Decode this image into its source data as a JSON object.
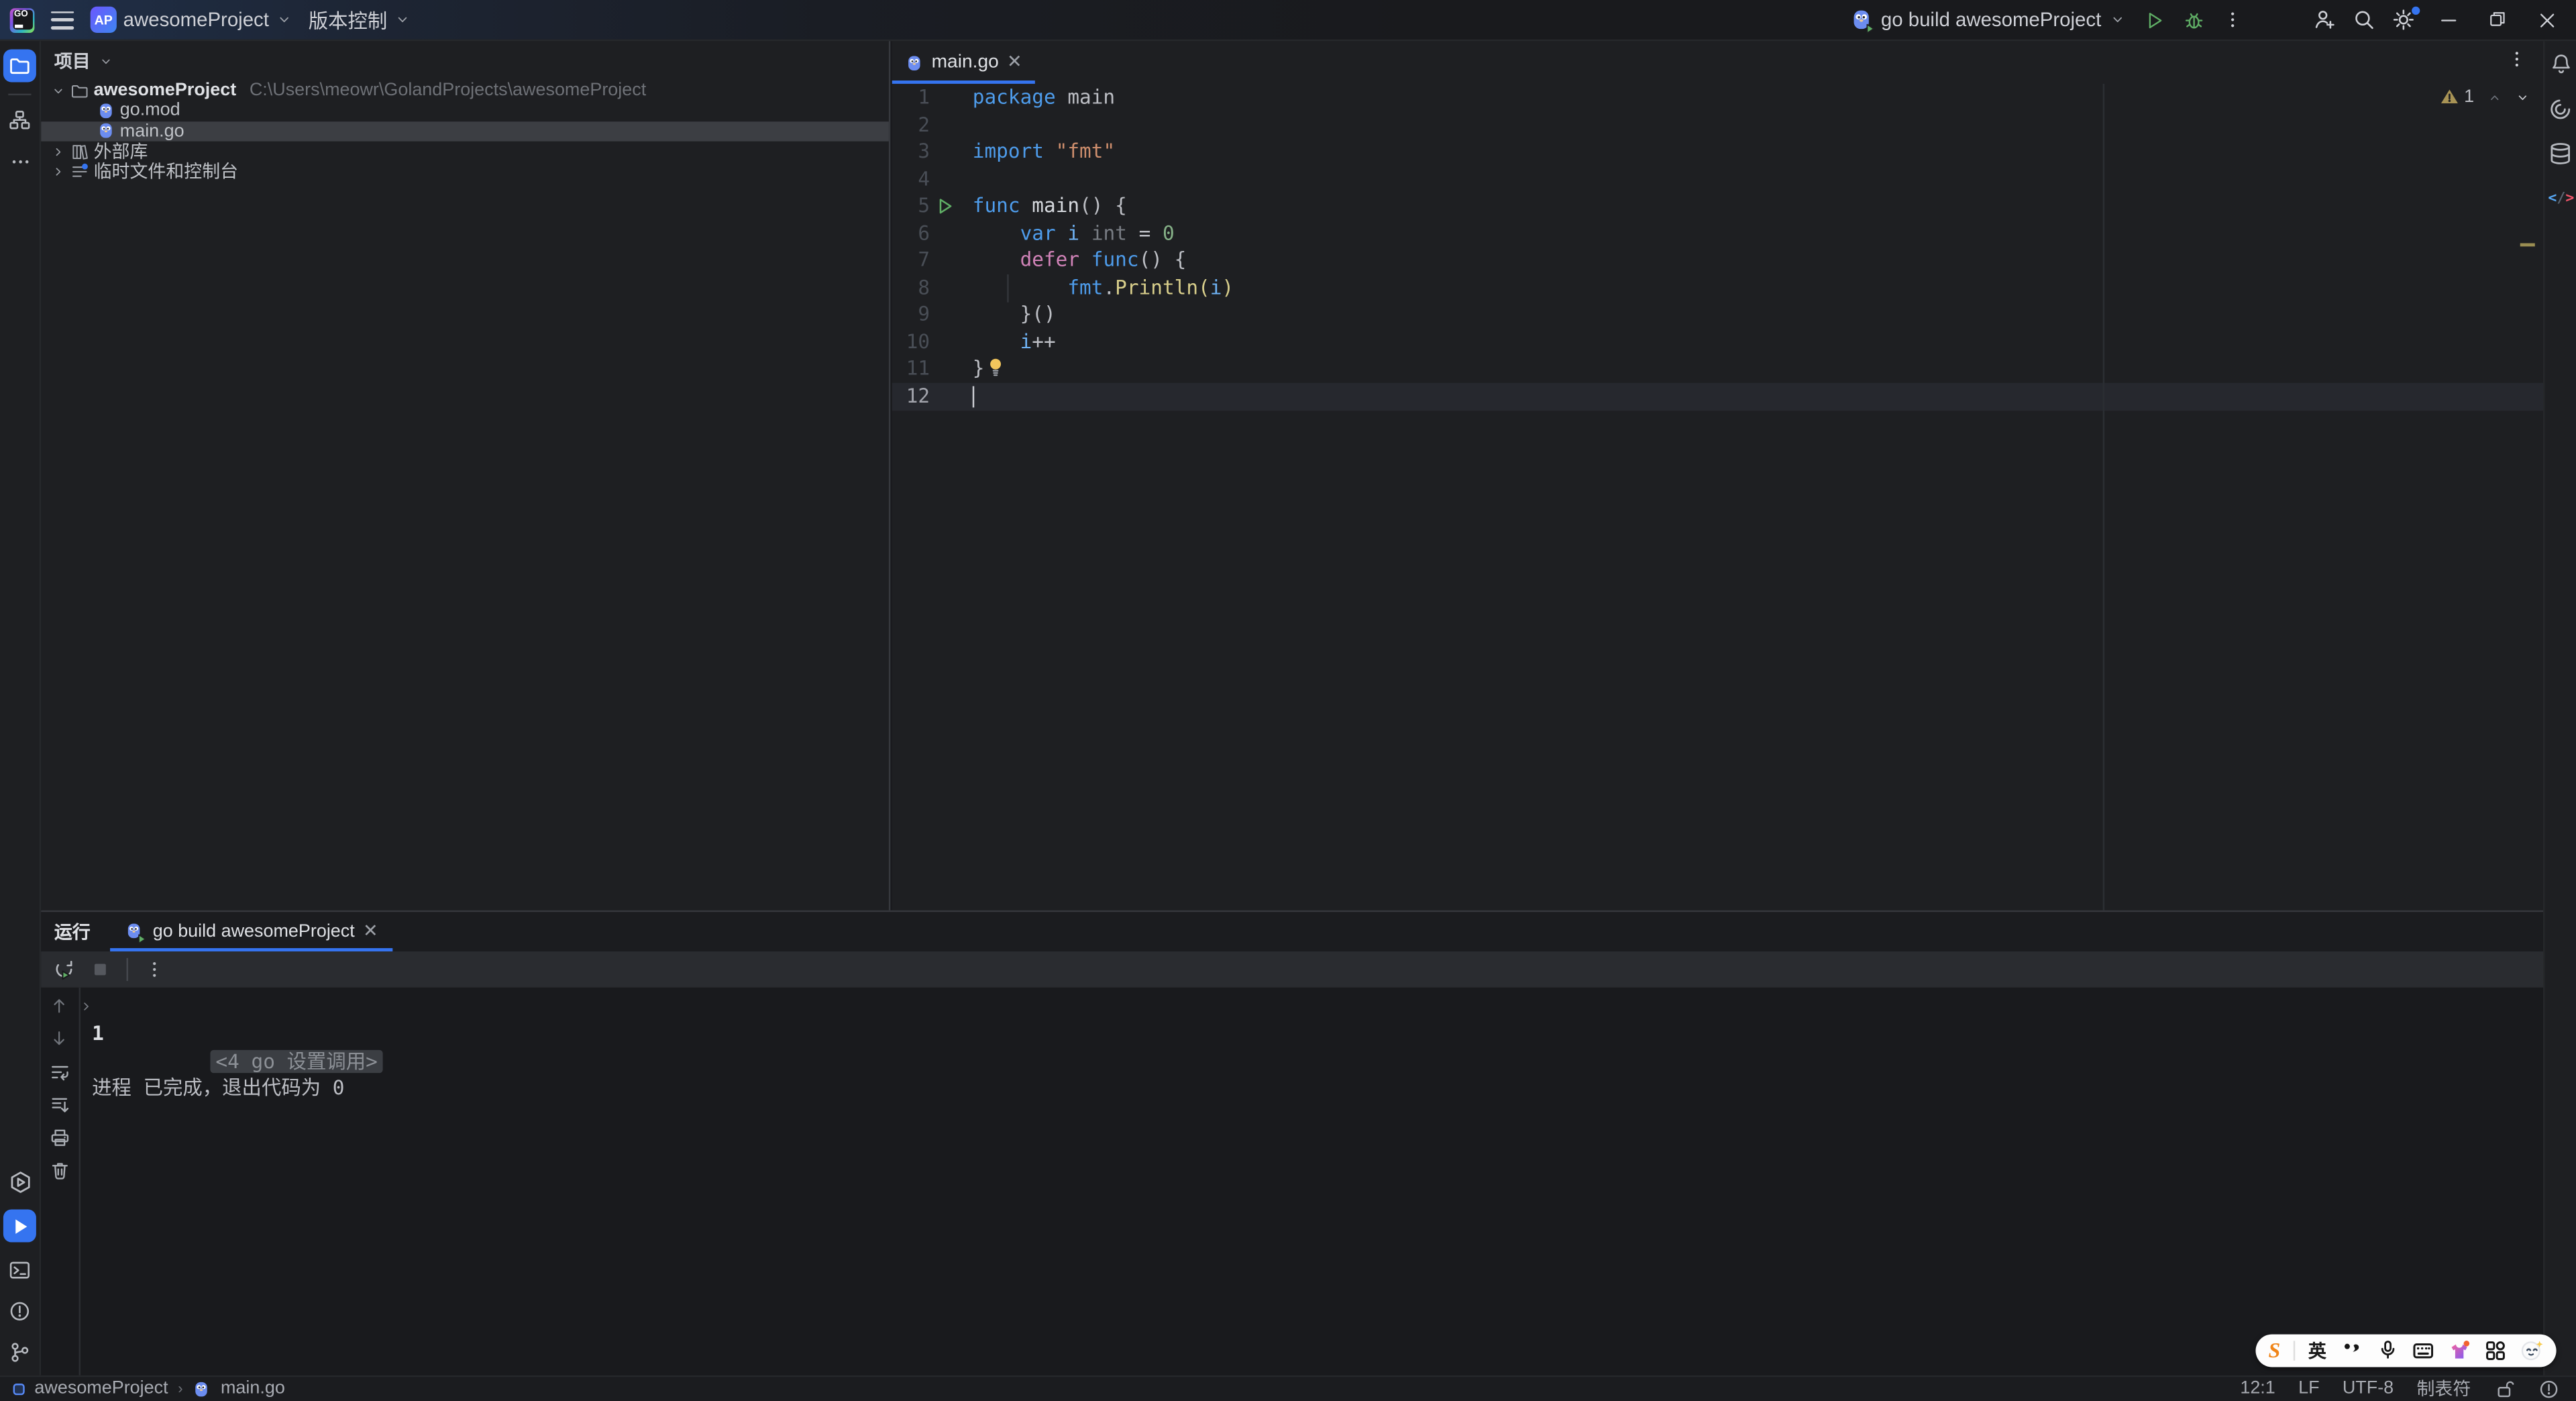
{
  "colors": {
    "accent": "#3574F0",
    "run_green": "#5FAD65",
    "warning": "#A89355",
    "selection": "#3C3E43"
  },
  "titlebar": {
    "project_badge": "AP",
    "project_name": "awesomeProject",
    "vcs_label": "版本控制",
    "run_config": "go build awesomeProject"
  },
  "project_panel": {
    "header": "项目",
    "root_name": "awesomeProject",
    "root_path": "C:\\Users\\meowr\\GolandProjects\\awesomeProject",
    "file_gomod": "go.mod",
    "file_maingo": "main.go",
    "external_libs": "外部库",
    "scratches": "临时文件和控制台"
  },
  "editor": {
    "tab_title": "main.go",
    "warning_count": "1",
    "lines": [
      {
        "n": "1",
        "tokens": [
          [
            "kw",
            "package"
          ],
          [
            "plain",
            " main"
          ]
        ]
      },
      {
        "n": "2",
        "tokens": []
      },
      {
        "n": "3",
        "tokens": [
          [
            "kw",
            "import"
          ],
          [
            "str",
            " \"fmt\""
          ]
        ]
      },
      {
        "n": "4",
        "tokens": []
      },
      {
        "n": "5",
        "run": true,
        "tokens": [
          [
            "kw",
            "func"
          ],
          [
            "plain",
            " "
          ],
          [
            "decl",
            "main"
          ],
          [
            "plain",
            "() {"
          ]
        ]
      },
      {
        "n": "6",
        "tokens": [
          [
            "plain",
            "    "
          ],
          [
            "kw",
            "var"
          ],
          [
            "plain",
            " "
          ],
          [
            "var",
            "i"
          ],
          [
            "type",
            " int"
          ],
          [
            "plain",
            " = "
          ],
          [
            "num",
            "0"
          ]
        ]
      },
      {
        "n": "7",
        "tokens": [
          [
            "plain",
            "    "
          ],
          [
            "kw2",
            "defer"
          ],
          [
            "plain",
            " "
          ],
          [
            "kw",
            "func"
          ],
          [
            "plain",
            "() {"
          ]
        ]
      },
      {
        "n": "8",
        "tokens": [
          [
            "plain",
            "        "
          ],
          [
            "kw",
            "fmt"
          ],
          [
            "plain",
            "."
          ],
          [
            "fn",
            "Println("
          ],
          [
            "var",
            "i"
          ],
          [
            "fn",
            ")"
          ]
        ]
      },
      {
        "n": "9",
        "tokens": [
          [
            "plain",
            "    }()"
          ]
        ]
      },
      {
        "n": "10",
        "tokens": [
          [
            "plain",
            "    "
          ],
          [
            "var",
            "i"
          ],
          [
            "plain",
            "++"
          ]
        ]
      },
      {
        "n": "11",
        "bulb": true,
        "tokens": [
          [
            "plain",
            "}"
          ]
        ]
      },
      {
        "n": "12",
        "caret": true,
        "tokens": []
      }
    ]
  },
  "run_panel": {
    "title": "运行",
    "tab_title": "go build awesomeProject",
    "console_fold": "<4 go 设置调用>",
    "console_out": "1",
    "console_exit": "进程 已完成，退出代码为 0"
  },
  "statusbar": {
    "crumb_project": "awesomeProject",
    "crumb_file": "main.go",
    "caret": "12:1",
    "line_sep": "LF",
    "encoding": "UTF-8",
    "indent": "制表符"
  },
  "ime": {
    "logo": "S",
    "lang": "英"
  }
}
